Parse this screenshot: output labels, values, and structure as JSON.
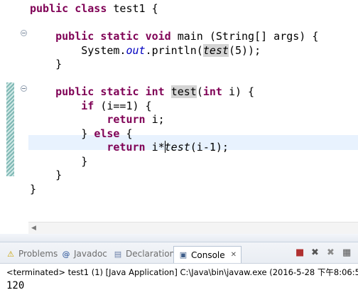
{
  "editor": {
    "lines": [
      [
        [
          "kw",
          "public"
        ],
        [
          "t",
          " "
        ],
        [
          "kw",
          "class"
        ],
        [
          "t",
          " test1 {"
        ]
      ],
      [
        [
          "t",
          ""
        ]
      ],
      [
        [
          "t",
          "    "
        ],
        [
          "kw",
          "public"
        ],
        [
          "t",
          " "
        ],
        [
          "kw",
          "static"
        ],
        [
          "t",
          " "
        ],
        [
          "kw",
          "void"
        ],
        [
          "t",
          " main (String[] args) {"
        ]
      ],
      [
        [
          "t",
          "        System."
        ],
        [
          "fld",
          "out"
        ],
        [
          "t",
          ".println("
        ],
        [
          "occ-it",
          "test"
        ],
        [
          "t",
          "(5));"
        ]
      ],
      [
        [
          "t",
          "    }"
        ]
      ],
      [
        [
          "t",
          ""
        ]
      ],
      [
        [
          "t",
          "    "
        ],
        [
          "kw",
          "public"
        ],
        [
          "t",
          " "
        ],
        [
          "kw",
          "static"
        ],
        [
          "t",
          " "
        ],
        [
          "kw",
          "int"
        ],
        [
          "t",
          " "
        ],
        [
          "occ",
          "test"
        ],
        [
          "t",
          "("
        ],
        [
          "kw",
          "int"
        ],
        [
          "t",
          " i) {"
        ]
      ],
      [
        [
          "t",
          "        "
        ],
        [
          "kw",
          "if"
        ],
        [
          "t",
          " (i==1) {"
        ]
      ],
      [
        [
          "t",
          "            "
        ],
        [
          "kw",
          "return"
        ],
        [
          "t",
          " i;"
        ]
      ],
      [
        [
          "t",
          "        } "
        ],
        [
          "kw",
          "else"
        ],
        [
          "t",
          " {"
        ]
      ],
      [
        [
          "t",
          "            "
        ],
        [
          "kw",
          "return"
        ],
        [
          "t",
          " i*"
        ],
        [
          "caret",
          ""
        ],
        [
          "it",
          "test"
        ],
        [
          "t",
          "(i-1);"
        ]
      ],
      [
        [
          "t",
          "        }"
        ]
      ],
      [
        [
          "t",
          "    }"
        ]
      ],
      [
        [
          "t",
          "}"
        ]
      ]
    ],
    "fold_markers": [
      2,
      6
    ]
  },
  "panel": {
    "tabs": [
      {
        "label": "Problems",
        "icon": "problems-icon",
        "glyph": "⚠",
        "active": false
      },
      {
        "label": "Javadoc",
        "icon": "javadoc-icon",
        "glyph": "@",
        "active": false
      },
      {
        "label": "Declaration",
        "icon": "declaration-icon",
        "glyph": "▤",
        "active": false
      },
      {
        "label": "Console",
        "icon": "console-icon",
        "glyph": "▣",
        "active": true
      }
    ],
    "tab_close": "✕",
    "status": "<terminated> test1 (1) [Java Application] C:\\Java\\bin\\javaw.exe (2016-5-28 下午8:06:5",
    "output": "120"
  },
  "colors": {
    "keyword": "#7f0055",
    "field": "#0000c0",
    "current_line": "#e8f2fe",
    "occurrence": "#d4d4d4"
  }
}
